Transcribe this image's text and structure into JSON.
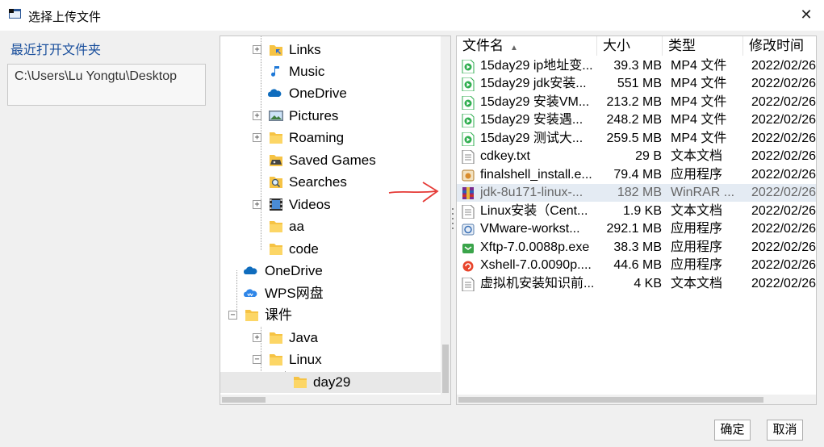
{
  "window": {
    "title": "选择上传文件",
    "close_glyph": "✕"
  },
  "recent": {
    "label": "最近打开文件夹",
    "path": "C:\\Users\\Lu Yongtu\\Desktop"
  },
  "tree": {
    "items": [
      {
        "label": "Links",
        "icon": "links-folder-icon"
      },
      {
        "label": "Music",
        "icon": "music-icon"
      },
      {
        "label": "OneDrive",
        "icon": "onedrive-icon"
      },
      {
        "label": "Pictures",
        "icon": "pictures-icon"
      },
      {
        "label": "Roaming",
        "icon": "folder-icon"
      },
      {
        "label": "Saved Games",
        "icon": "saved-games-icon"
      },
      {
        "label": "Searches",
        "icon": "searches-icon"
      },
      {
        "label": "Videos",
        "icon": "videos-icon"
      },
      {
        "label": "aa",
        "icon": "folder-icon"
      },
      {
        "label": "code",
        "icon": "folder-icon"
      },
      {
        "label": "OneDrive",
        "icon": "onedrive-icon"
      },
      {
        "label": "WPS网盘",
        "icon": "wps-cloud-icon"
      },
      {
        "label": "课件",
        "icon": "folder-icon"
      },
      {
        "label": "Java",
        "icon": "folder-icon"
      },
      {
        "label": "Linux",
        "icon": "folder-icon"
      },
      {
        "label": "day29",
        "icon": "folder-icon",
        "selected": true
      }
    ],
    "expand_plus": "+",
    "expand_minus": "−"
  },
  "files": {
    "columns": {
      "name": "文件名",
      "size": "大小",
      "type": "类型",
      "modified": "修改时间"
    },
    "sort_indicator": "▲",
    "rows": [
      {
        "name": "15day29 ip地址变...",
        "size": "39.3 MB",
        "type": "MP4 文件",
        "modified": "2022/02/26",
        "icon": "mp4-file-icon"
      },
      {
        "name": "15day29 jdk安装...",
        "size": "551 MB",
        "type": "MP4 文件",
        "modified": "2022/02/26",
        "icon": "mp4-file-icon"
      },
      {
        "name": "15day29 安装VM...",
        "size": "213.2 MB",
        "type": "MP4 文件",
        "modified": "2022/02/26",
        "icon": "mp4-file-icon"
      },
      {
        "name": "15day29 安装遇...",
        "size": "248.2 MB",
        "type": "MP4 文件",
        "modified": "2022/02/26",
        "icon": "mp4-file-icon"
      },
      {
        "name": "15day29 测试大...",
        "size": "259.5 MB",
        "type": "MP4 文件",
        "modified": "2022/02/26",
        "icon": "mp4-file-icon"
      },
      {
        "name": "cdkey.txt",
        "size": "29 B",
        "type": "文本文档",
        "modified": "2022/02/26",
        "icon": "text-file-icon"
      },
      {
        "name": "finalshell_install.e...",
        "size": "79.4 MB",
        "type": "应用程序",
        "modified": "2022/02/26",
        "icon": "installer-icon"
      },
      {
        "name": "jdk-8u171-linux-...",
        "size": "182 MB",
        "type": "WinRAR ...",
        "modified": "2022/02/26",
        "icon": "winrar-icon",
        "selected": true
      },
      {
        "name": "Linux安装（Cent...",
        "size": "1.9 KB",
        "type": "文本文档",
        "modified": "2022/02/26",
        "icon": "text-file-icon"
      },
      {
        "name": "VMware-workst...",
        "size": "292.1 MB",
        "type": "应用程序",
        "modified": "2022/02/26",
        "icon": "vmware-icon"
      },
      {
        "name": "Xftp-7.0.0088p.exe",
        "size": "38.3 MB",
        "type": "应用程序",
        "modified": "2022/02/26",
        "icon": "xftp-icon"
      },
      {
        "name": "Xshell-7.0.0090p....",
        "size": "44.6 MB",
        "type": "应用程序",
        "modified": "2022/02/26",
        "icon": "xshell-icon"
      },
      {
        "name": "虚拟机安装知识前...",
        "size": "4 KB",
        "type": "文本文档",
        "modified": "2022/02/26",
        "icon": "text-file-icon"
      }
    ]
  },
  "buttons": {
    "ok": "确定",
    "cancel": "取消"
  },
  "colors": {
    "accent_link": "#1a4f9c",
    "selection": "#e4ebf3",
    "annotation_arrow": "#e53935",
    "folder": "#f6c344",
    "mp4": "#2fae4f"
  }
}
